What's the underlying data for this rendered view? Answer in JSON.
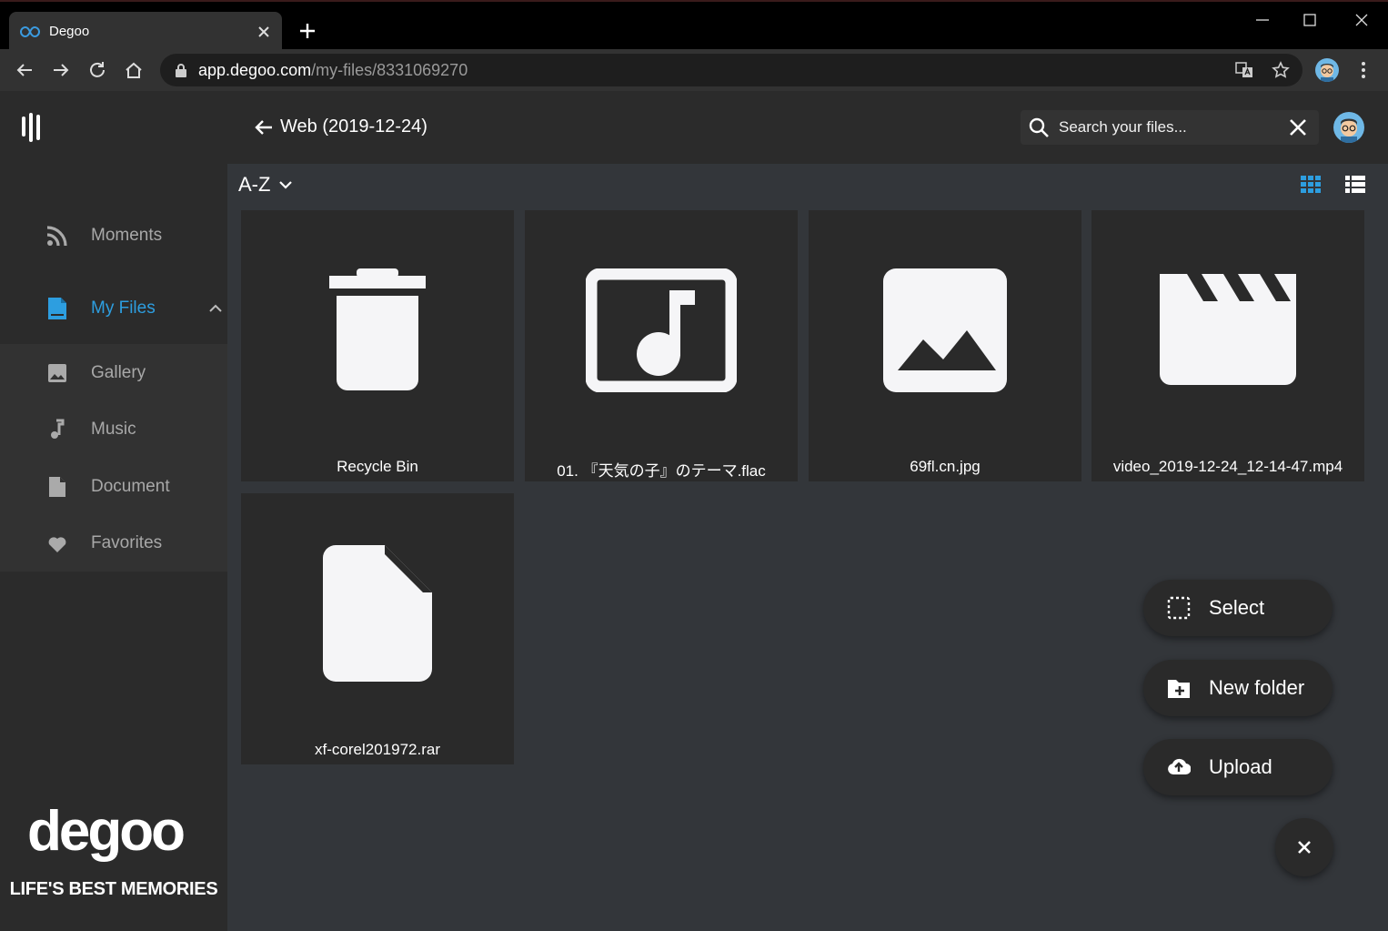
{
  "browser": {
    "tab_title": "Degoo",
    "url_host": "app.degoo.com",
    "url_path": "/my-files/8331069270"
  },
  "sidebar": {
    "items": [
      {
        "label": "Moments",
        "icon": "rss-icon"
      },
      {
        "label": "My Files",
        "icon": "file-icon"
      },
      {
        "label": "Gallery",
        "icon": "image-icon"
      },
      {
        "label": "Music",
        "icon": "music-note-icon"
      },
      {
        "label": "Document",
        "icon": "document-icon"
      },
      {
        "label": "Favorites",
        "icon": "heart-icon"
      }
    ],
    "tagline": "LIFE'S BEST MEMORIES",
    "logo_text": "degoo",
    "accent_color": "#2d9ee0"
  },
  "header": {
    "breadcrumb": "Web (2019-12-24)",
    "search_placeholder": "Search your files...",
    "sort_label": "A-Z"
  },
  "files": [
    {
      "name": "Recycle Bin",
      "icon": "trash-icon"
    },
    {
      "name": "01. 『天気の子』のテーマ.flac",
      "icon": "audio-file-icon"
    },
    {
      "name": "69fl.cn.jpg",
      "icon": "image-file-icon"
    },
    {
      "name": "video_2019-12-24_12-14-47.mp4",
      "icon": "video-file-icon"
    },
    {
      "name": "xf-corel201972.rar",
      "icon": "generic-file-icon"
    }
  ],
  "actions": {
    "select_label": "Select",
    "new_folder_label": "New folder",
    "upload_label": "Upload"
  }
}
